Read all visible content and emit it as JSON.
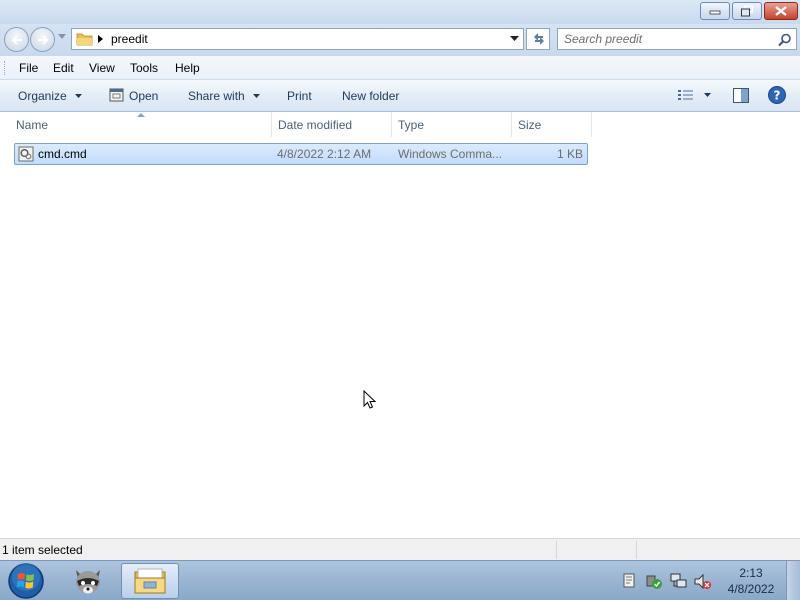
{
  "window": {
    "controls": [
      "minimize-icon",
      "restore-icon",
      "close-icon"
    ]
  },
  "address": {
    "path": "preedit",
    "search_placeholder": "Search preedit"
  },
  "menu": {
    "items": [
      "File",
      "Edit",
      "View",
      "Tools",
      "Help"
    ]
  },
  "commandbar": {
    "organize": "Organize",
    "open": "Open",
    "share_with": "Share with",
    "print": "Print",
    "new_folder": "New folder"
  },
  "columns": {
    "name": "Name",
    "date_modified": "Date modified",
    "type": "Type",
    "size": "Size"
  },
  "files": [
    {
      "name": "cmd.cmd",
      "date_modified": "4/8/2022 2:12 AM",
      "type": "Windows Comma...",
      "size": "1 KB",
      "selected": true
    }
  ],
  "status": {
    "text": "1 item selected"
  },
  "taskbar": {
    "time": "2:13",
    "date": "4/8/2022"
  },
  "colors": {
    "selection_fill": "#cce4fc",
    "selection_border": "#7da2ce",
    "chrome_blue": "#c9daee",
    "taskbar": "#9cb6d3"
  }
}
